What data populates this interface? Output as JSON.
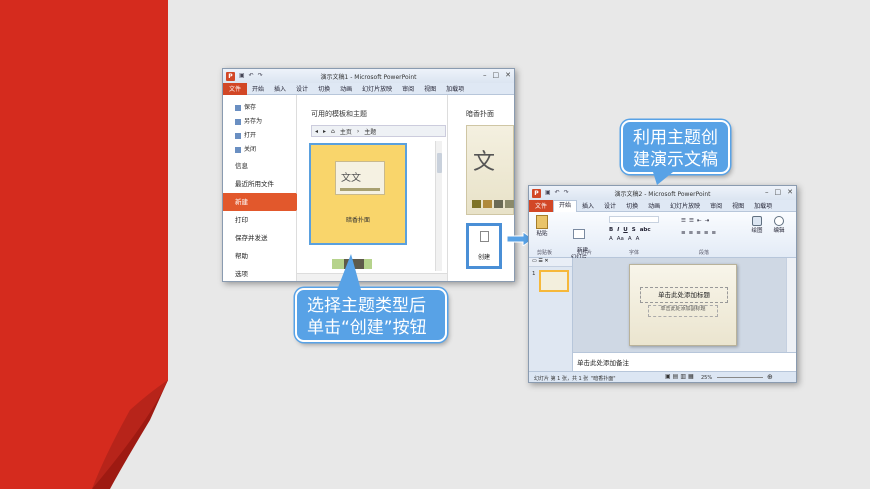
{
  "left_window": {
    "title": "演示文稿1 - Microsoft PowerPoint",
    "tabs": [
      "文件",
      "开始",
      "插入",
      "设计",
      "切换",
      "动画",
      "幻灯片放映",
      "审阅",
      "视图",
      "加载项"
    ],
    "backstage": {
      "small_items": [
        "保存",
        "另存为",
        "打开",
        "关闭"
      ],
      "items": [
        "信息",
        "最近所用文件",
        "新建",
        "打印",
        "保存并发送",
        "帮助",
        "选项"
      ]
    },
    "panel_title": "可用的模板和主题",
    "breadcrumb_home": "主页",
    "breadcrumb_current": "主题",
    "selected_theme_label": "暗香扑面",
    "theme_thumb_text": "文文",
    "preview_title": "暗香扑面",
    "preview_glyph": "文",
    "create_label": "创建"
  },
  "right_window": {
    "title": "演示文稿2 - Microsoft PowerPoint",
    "tabs": [
      "文件",
      "开始",
      "插入",
      "设计",
      "切换",
      "动画",
      "幻灯片放映",
      "审阅",
      "视图",
      "加载项"
    ],
    "ribbon": {
      "paste": "粘贴",
      "new_slide": "新建\n幻灯片",
      "drawing": "绘图",
      "editing": "编辑",
      "groups": [
        "剪贴板",
        "幻灯片",
        "字体",
        "段落"
      ]
    },
    "slide_number": "1",
    "placeholder_title": "单击此处添加标题",
    "placeholder_subtitle": "单击此处添加副标题",
    "notes_placeholder": "单击此处添加备注",
    "status_slide": "幻灯片 第 1 张，共 1 张",
    "status_theme": "\"暗香扑面\"",
    "status_zoom": "25%"
  },
  "callout_left": "选择主题类型后单击“创建”按钮",
  "callout_right": "利用主题创建演示文稿",
  "colors": {
    "accent": "#58a2e6",
    "red": "#d52b1e",
    "orange": "#e2582c",
    "theme_yellow": "#f9d56b"
  }
}
